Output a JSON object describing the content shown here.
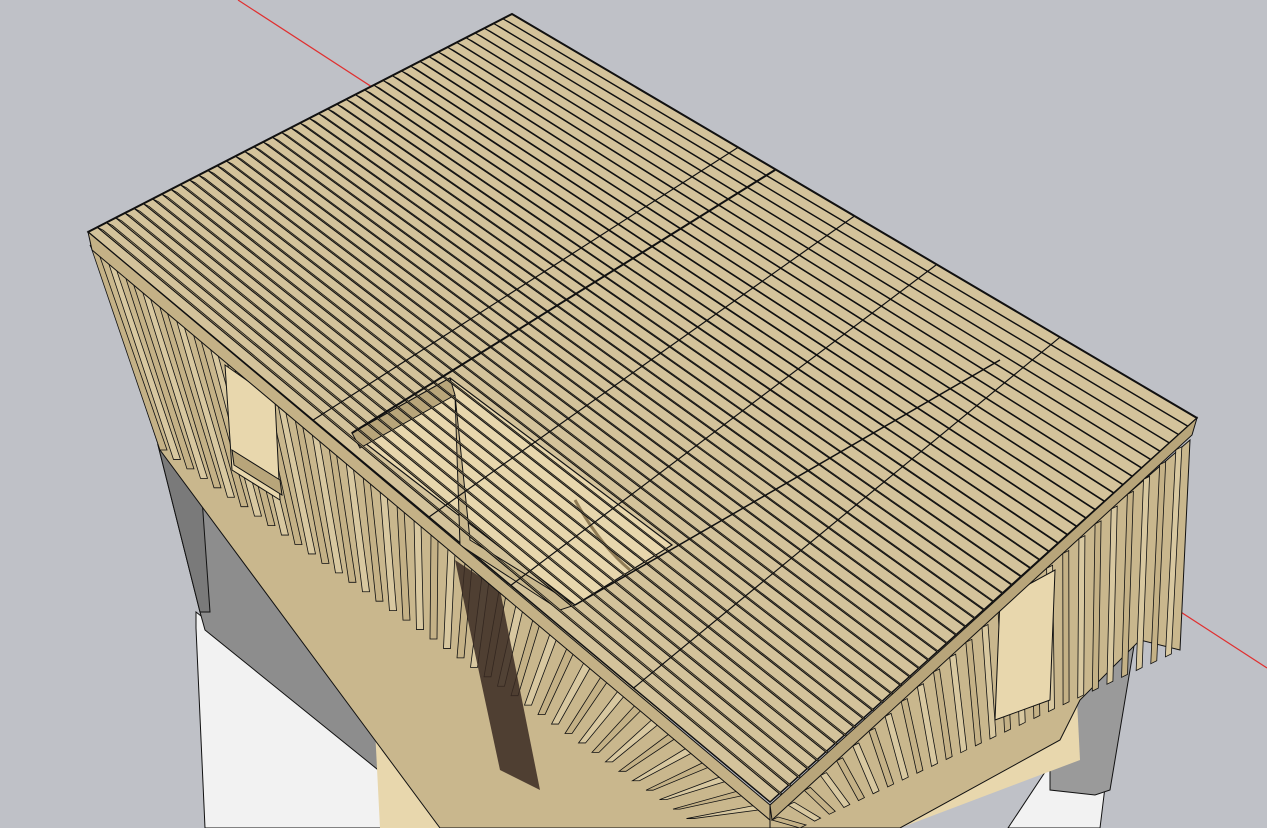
{
  "viewport": {
    "description_empty": "",
    "background_color": "#bfc1c7"
  },
  "model": {
    "lumber_color": "#d4c39b",
    "lumber_shade_color": "#b8a57a",
    "lumber_dark_color": "#8f7b55",
    "floor_color": "#e8d7ad",
    "masonry_color": "#8d8d8d",
    "masonry_light_color": "#a3a3a3",
    "footing_color": "#f2f2f2",
    "opening_color": "#3a2a22",
    "edge_color": "#111111"
  },
  "axes": {
    "red_axis_color": "#e03030"
  }
}
